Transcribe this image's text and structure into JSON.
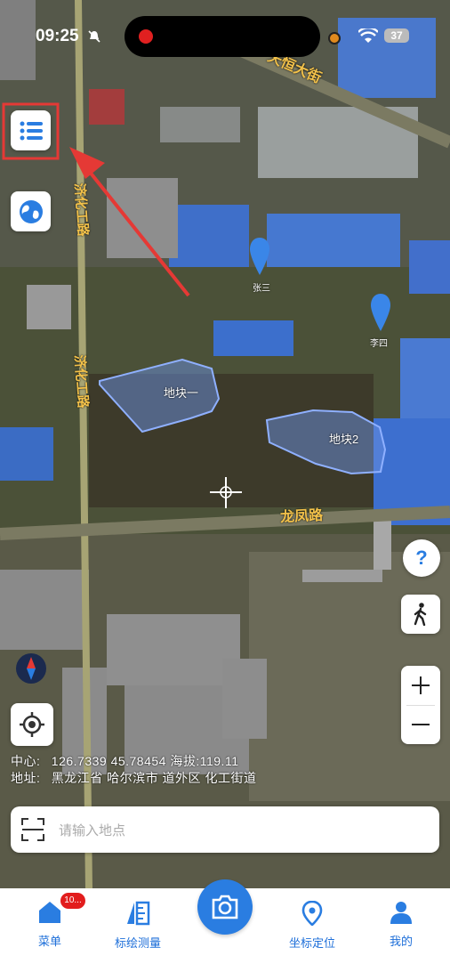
{
  "status_bar": {
    "time": "09:25",
    "battery": "37"
  },
  "map": {
    "roads": {
      "north": "天恒大街",
      "west_upper": "济化工路",
      "west_lower": "济化工路",
      "south": "龙凤路"
    },
    "markers": [
      {
        "label": "张三"
      },
      {
        "label": "李四"
      }
    ],
    "parcels": [
      {
        "label": "地块一"
      },
      {
        "label": "地块2"
      }
    ]
  },
  "info": {
    "center_label": "中心:",
    "center_value": "126.7339 45.78454 海拔:119.11",
    "address_label": "地址:",
    "address_value": "黑龙江省 哈尔滨市 道外区 化工街道"
  },
  "search": {
    "placeholder": "请输入地点"
  },
  "tabs": [
    {
      "label": "菜单",
      "icon": "home-icon"
    },
    {
      "label": "标绘测量",
      "icon": "ruler-icon"
    },
    {
      "label": "坐标定位",
      "icon": "location-pin-icon"
    },
    {
      "label": "我的",
      "icon": "person-icon"
    }
  ],
  "menu_badge": "10...",
  "colors": {
    "accent": "#2a7de1",
    "road_label": "#f2c14a",
    "highlight_box": "#e53935",
    "parcel_fill": "#6a8fe0"
  }
}
